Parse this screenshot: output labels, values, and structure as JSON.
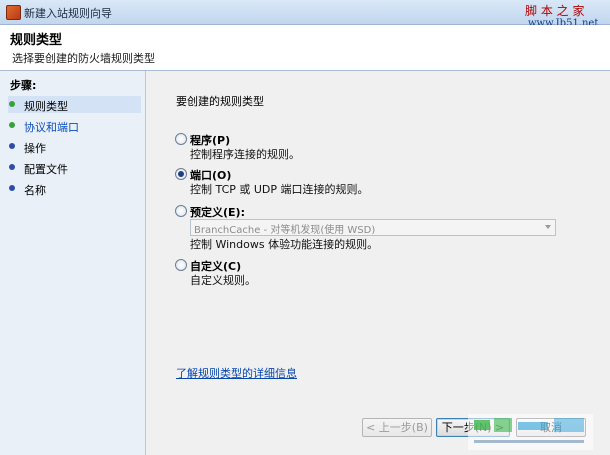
{
  "window": {
    "title": "新建入站规则向导",
    "watermark_site": "脚 本 之 家",
    "watermark_url": "www.Jb51.net",
    "watermark_logo": "jiaocheng.chazidian.com 查字典 教程网"
  },
  "header": {
    "title": "规则类型",
    "subtitle": "选择要创建的防火墙规则类型"
  },
  "steps": {
    "title": "步骤:",
    "items": [
      {
        "label": "规则类型"
      },
      {
        "label": "协议和端口"
      },
      {
        "label": "操作"
      },
      {
        "label": "配置文件"
      },
      {
        "label": "名称"
      }
    ]
  },
  "main": {
    "question": "要创建的规则类型",
    "options": [
      {
        "label": "程序(P)",
        "desc": "控制程序连接的规则。",
        "checked": false
      },
      {
        "label": "端口(O)",
        "desc": "控制 TCP 或 UDP 端口连接的规则。",
        "checked": true
      },
      {
        "label": "预定义(E):",
        "desc": "控制 Windows 体验功能连接的规则。",
        "checked": false
      },
      {
        "label": "自定义(C)",
        "desc": "自定义规则。",
        "checked": false
      }
    ],
    "predefined_select": "BranchCache - 对等机发现(使用 WSD)",
    "learn_more": "了解规则类型的详细信息"
  },
  "buttons": {
    "back": "< 上一步(B)",
    "next": "下一步(N) >",
    "cancel": "取消"
  },
  "colors": {
    "accent": "#0b4db8",
    "step_dot_done": "#3aa13a",
    "step_dot_pending": "#2c4fa4"
  }
}
